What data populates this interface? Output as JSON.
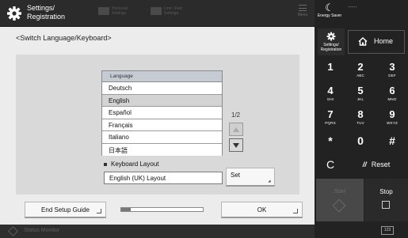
{
  "header": {
    "title": "Settings/\nRegistration",
    "faint_items": [
      "Personal\nSettings",
      "Line / Fwd\nSettings"
    ],
    "menu_label": "Menu"
  },
  "breadcrumb": "<Switch Language/Keyboard>",
  "language_list": {
    "header": "Language",
    "items": [
      "Deutsch",
      "English",
      "Español",
      "Français",
      "Italiano",
      "日本語"
    ],
    "selected": "English"
  },
  "pager": {
    "text": "1/2"
  },
  "keyboard": {
    "label": "Keyboard Layout",
    "value": "English (UK) Layout",
    "set_label": "Set"
  },
  "footer": {
    "end_setup_label": "End Setup Guide",
    "ok_label": "OK",
    "progress": 0.12
  },
  "status_bar": {
    "label": "Status Monitor"
  },
  "side": {
    "energy_label": "Energy Saver",
    "dash": "-----",
    "settings_label": "Settings/\nRegistration",
    "home_label": "Home",
    "keys": [
      {
        "n": "1",
        "l": ""
      },
      {
        "n": "2",
        "l": "ABC"
      },
      {
        "n": "3",
        "l": "DEF"
      },
      {
        "n": "4",
        "l": "GHI"
      },
      {
        "n": "5",
        "l": "JKL"
      },
      {
        "n": "6",
        "l": "MNO"
      },
      {
        "n": "7",
        "l": "PQRS"
      },
      {
        "n": "8",
        "l": "TUV"
      },
      {
        "n": "9",
        "l": "WXYZ"
      },
      {
        "n": "*",
        "l": ""
      },
      {
        "n": "0",
        "l": ""
      },
      {
        "n": "#",
        "l": ""
      }
    ],
    "clear_label": "C",
    "reset_label": "Reset",
    "start_label": "Start",
    "stop_label": "Stop",
    "counter_label": "123"
  }
}
